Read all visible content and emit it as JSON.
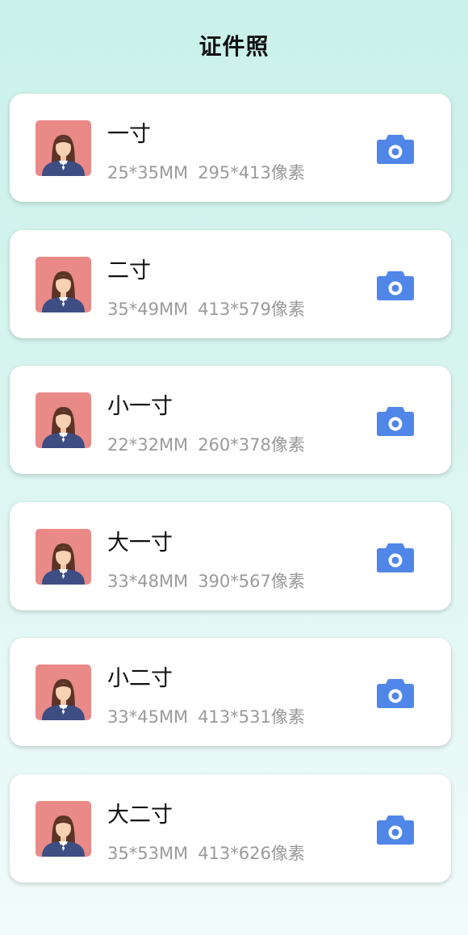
{
  "page": {
    "title": "证件照"
  },
  "colors": {
    "accent": "#4f86e8",
    "avatar_bg": "#e98a88",
    "secondary_text": "#9a9a9a"
  },
  "items": [
    {
      "name": "一寸",
      "mm": "25*35MM",
      "px": "295*413像素",
      "icon": "camera-icon"
    },
    {
      "name": "二寸",
      "mm": "35*49MM",
      "px": "413*579像素",
      "icon": "camera-icon"
    },
    {
      "name": "小一寸",
      "mm": "22*32MM",
      "px": "260*378像素",
      "icon": "camera-icon"
    },
    {
      "name": "大一寸",
      "mm": "33*48MM",
      "px": "390*567像素",
      "icon": "camera-icon"
    },
    {
      "name": "小二寸",
      "mm": "33*45MM",
      "px": "413*531像素",
      "icon": "camera-icon"
    },
    {
      "name": "大二寸",
      "mm": "35*53MM",
      "px": "413*626像素",
      "icon": "camera-icon"
    }
  ]
}
